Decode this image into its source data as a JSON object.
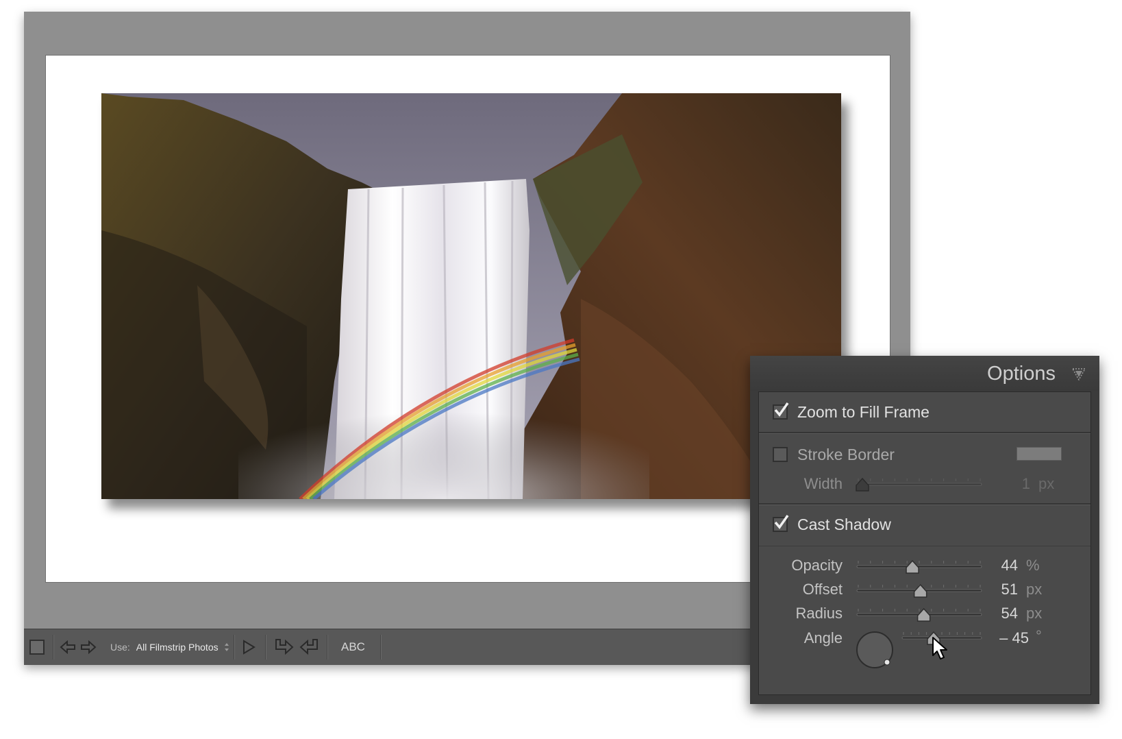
{
  "toolbar": {
    "use_label": "Use:",
    "use_value": "All Filmstrip Photos",
    "abc_label": "ABC"
  },
  "options": {
    "title": "Options",
    "zoom_to_fill": {
      "label": "Zoom to Fill Frame",
      "checked": true
    },
    "stroke_border": {
      "label": "Stroke Border",
      "checked": false,
      "color": "#7c7c7c",
      "width": {
        "label": "Width",
        "value": "1",
        "unit": "px",
        "fraction": 0.0
      }
    },
    "cast_shadow": {
      "label": "Cast Shadow",
      "checked": true,
      "opacity": {
        "label": "Opacity",
        "value": "44",
        "unit": "%",
        "fraction": 0.44
      },
      "offset": {
        "label": "Offset",
        "value": "51",
        "unit": "px",
        "fraction": 0.51
      },
      "radius": {
        "label": "Radius",
        "value": "54",
        "unit": "px",
        "fraction": 0.54
      },
      "angle": {
        "label": "Angle",
        "value": "– 45",
        "unit": "°",
        "fraction": 0.38
      }
    }
  },
  "colors": {
    "window_bg": "#8f8f8f",
    "toolbar_bg": "#585858",
    "panel_bg": "#3b3b3b",
    "panel_body_bg": "#4a4a4a"
  }
}
